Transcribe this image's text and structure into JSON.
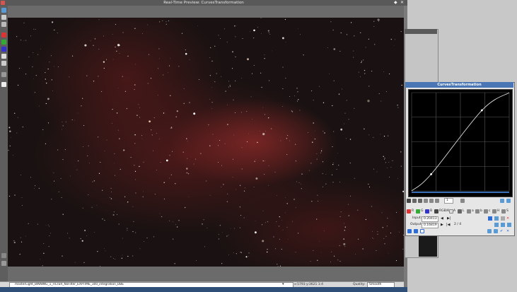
{
  "window": {
    "title": "Real-Time Preview: CurvesTransformation",
    "dock_glyph": "◆",
    "close_glyph": "✕"
  },
  "toolbar_icons": [
    "preview-icon",
    "zoom-icon",
    "pan-icon",
    "red-channel-icon",
    "green-channel-icon",
    "blue-channel-icon",
    "rgb-icon",
    "luminance-icon",
    "rotate-icon",
    "print-icon",
    "grid-icon",
    "cursor-icon"
  ],
  "statusbar": {
    "filename": "masterLight_BINNING_1_FILTER_NoFilter_EXPTIME_300_integration_DBE",
    "coords": "x:5793  y:3621  1:4",
    "quality_label": "Quality:",
    "quality_value": "Smooth"
  },
  "curves": {
    "title": "CurvesTransformation",
    "zoom_value": "1",
    "channels": [
      "R",
      "G",
      "B",
      "RGB/K",
      "A",
      "L",
      "a",
      "b",
      "c",
      "H",
      "S"
    ],
    "input_label": "Input:",
    "input_value": "0.20413",
    "output_label": "Output:",
    "output_value": "0.16819",
    "point_counter": "2 / 4",
    "curve_points": [
      [
        0,
        0
      ],
      [
        0.2,
        0.17
      ],
      [
        0.72,
        0.82
      ],
      [
        1,
        1
      ]
    ]
  },
  "colors": {
    "title_blue": "#4a76b5",
    "red_channel": "#d33",
    "green_channel": "#3a3",
    "blue_channel": "#33c"
  }
}
